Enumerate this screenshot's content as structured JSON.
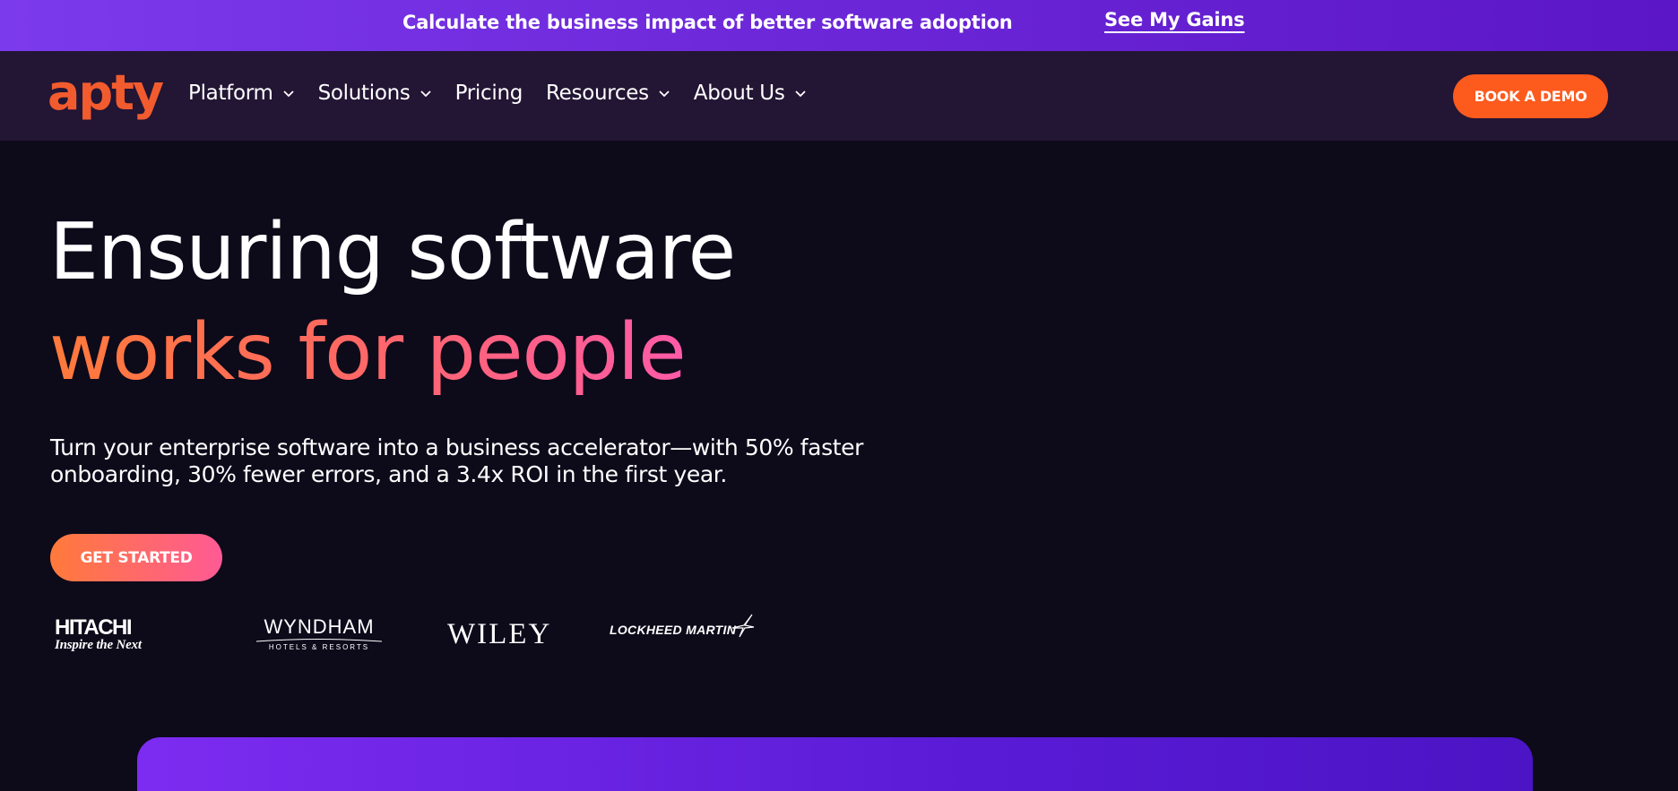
{
  "announcement": {
    "text": "Calculate the business impact of better software adoption",
    "link_label": "See My Gains"
  },
  "nav": {
    "logo_text": "apty",
    "items": [
      {
        "label": "Platform",
        "has_dropdown": true
      },
      {
        "label": "Solutions",
        "has_dropdown": true
      },
      {
        "label": "Pricing",
        "has_dropdown": false
      },
      {
        "label": "Resources",
        "has_dropdown": true
      },
      {
        "label": "About Us",
        "has_dropdown": true
      }
    ],
    "cta_label": "BOOK A DEMO"
  },
  "hero": {
    "title_line1": "Ensuring software",
    "title_line2": "works for people",
    "subtitle": "Turn your enterprise software into a business accelerator—with 50% faster onboarding, 30% fewer errors, and a 3.4x ROI in the first year.",
    "cta_label": "GET STARTED"
  },
  "customer_logos": {
    "hitachi": {
      "line1": "HITACHI",
      "line2": "Inspire the Next"
    },
    "wyndham": {
      "line1": "WYNDHAM",
      "line2": "HOTELS & RESORTS"
    },
    "wiley": {
      "line1": "WILEY"
    },
    "lockheed": {
      "line1": "LOCKHEED MARTIN"
    }
  },
  "colors": {
    "brand_orange": "#f25b2e",
    "cta_orange": "#fd5a1e",
    "purple_bar": "#7c3aed",
    "nav_bg": "#231534",
    "page_bg": "#0d0a1a",
    "gradient_pink": "#ff5aa8"
  },
  "icons": {
    "dropdown": "chevron-down-icon",
    "lockheed_star": "star-icon"
  }
}
